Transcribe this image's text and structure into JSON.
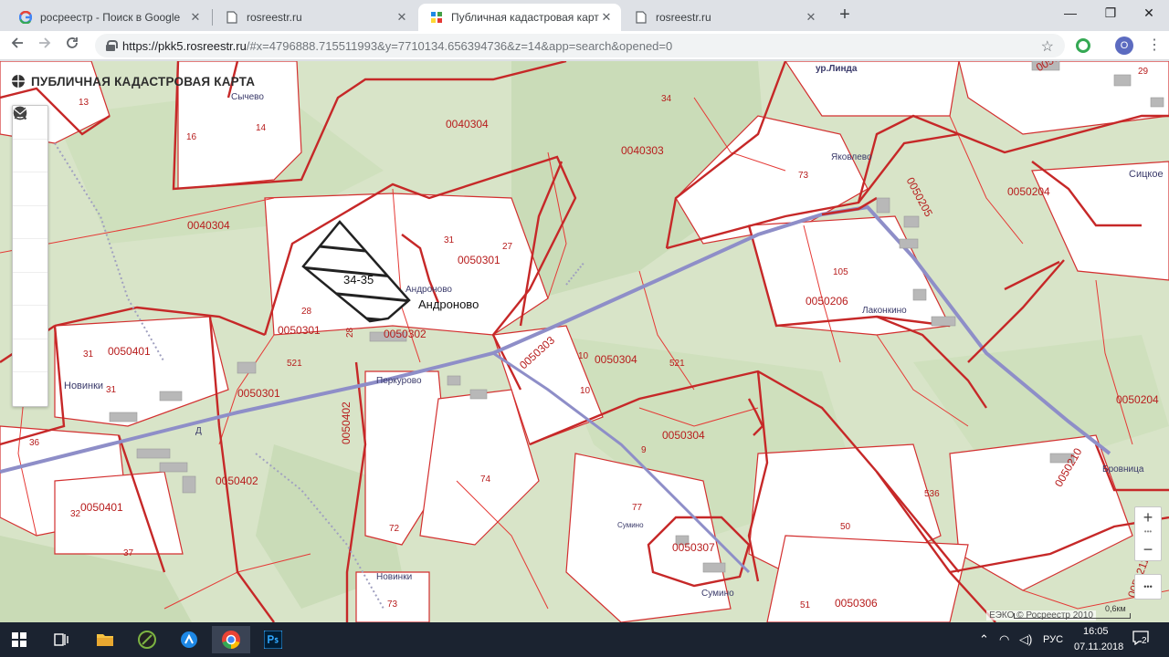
{
  "browser": {
    "tabs": [
      {
        "title": "росреестр - Поиск в Google",
        "favicon": "google-icon",
        "active": false
      },
      {
        "title": "rosreestr.ru",
        "favicon": "page-icon",
        "active": false
      },
      {
        "title": "Публичная кадастровая карта",
        "favicon": "pkk-icon",
        "active": true
      },
      {
        "title": "rosreestr.ru",
        "favicon": "page-icon",
        "active": false
      }
    ],
    "close_glyph": "✕",
    "new_tab_glyph": "+",
    "url_host": "https://pkk5.rosreestr.ru",
    "url_rest": "/#x=4796888.715511993&y=7710134.656394736&z=14&app=search&opened=0",
    "profile_initial": "O",
    "window": {
      "minimize": "—",
      "maximize": "❐",
      "close": "✕"
    }
  },
  "map": {
    "brand": "ПУБЛИЧНАЯ КАДАСТРОВАЯ КАРТА",
    "tools": [
      "search-icon",
      "info-icon",
      "layers-icon",
      "pencil-icon",
      "measure-icon",
      "star-icon",
      "print-icon",
      "help-icon",
      "mail-icon"
    ],
    "selected_parcel": "34-35",
    "quarter_labels": [
      "0040304",
      "0040303",
      "0040304",
      "0050301",
      "0050302",
      "0050301",
      "0050401",
      "0050301",
      "0050402",
      "0050402",
      "0050401",
      "0050303",
      "0050304",
      "0050304",
      "0050206",
      "0050205",
      "0050204",
      "0050204",
      "0050210",
      "0050307",
      "0050306",
      "0050211",
      "0050205"
    ],
    "parcel_numbers": [
      "13",
      "16",
      "14",
      "34",
      "73",
      "31",
      "27",
      "28",
      "28",
      "31",
      "31",
      "521",
      "36",
      "32",
      "37",
      "72",
      "73",
      "74",
      "77",
      "9",
      "10",
      "10",
      "521",
      "105",
      "536",
      "50",
      "51",
      "29"
    ],
    "places": [
      "ур.Линда",
      "Сычево",
      "Яковлево",
      "Андроново",
      "Андроново",
      "Перкурово",
      "Новинки",
      "Новинки",
      "Лаконкино",
      "Сумино",
      "Сумино",
      "Сицкое",
      "Бровница",
      "Д"
    ],
    "attribution": "ЕЭКО © Росреестр 2010",
    "scale": "0,6км",
    "zoom_in": "+",
    "zoom_out": "−",
    "more": "•••"
  },
  "taskbar": {
    "language": "РУС",
    "time": "16:05",
    "date": "07.11.2018",
    "notifications": "2"
  }
}
